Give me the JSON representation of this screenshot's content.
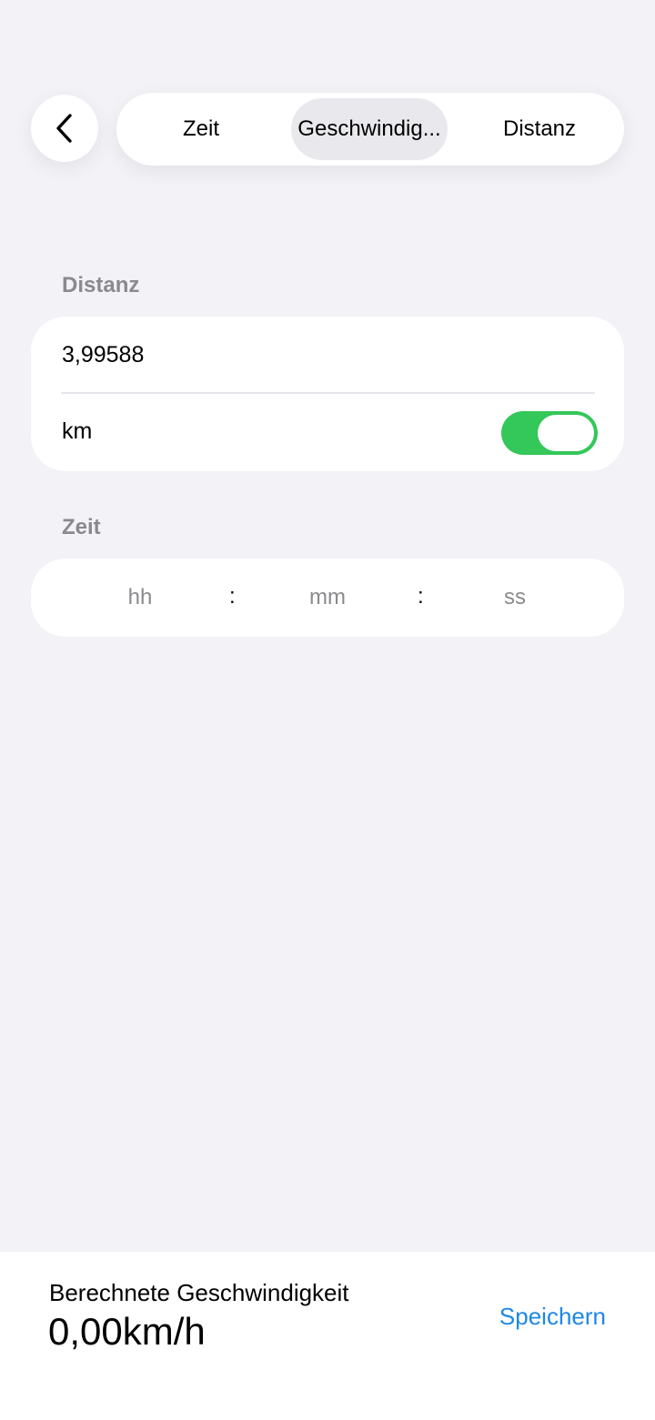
{
  "nav": {
    "back_icon": "chevron-left-icon",
    "tabs": [
      {
        "label": "Zeit",
        "selected": false
      },
      {
        "label": "Geschwindig...",
        "selected": true
      },
      {
        "label": "Distanz",
        "selected": false
      }
    ]
  },
  "distance_section": {
    "label": "Distanz",
    "value": "3,99588",
    "unit_label": "km",
    "unit_toggle_on": true
  },
  "time_section": {
    "label": "Zeit",
    "hours_placeholder": "hh",
    "minutes_placeholder": "mm",
    "seconds_placeholder": "ss",
    "separator": ":"
  },
  "result": {
    "title": "Berechnete Geschwindigkeit",
    "value": "0,00km/h",
    "save_label": "Speichern"
  },
  "colors": {
    "background": "#F2F2F7",
    "toggle_on": "#34C759",
    "accent_link": "#1E88E5",
    "secondary_text": "#8A8A8E"
  }
}
